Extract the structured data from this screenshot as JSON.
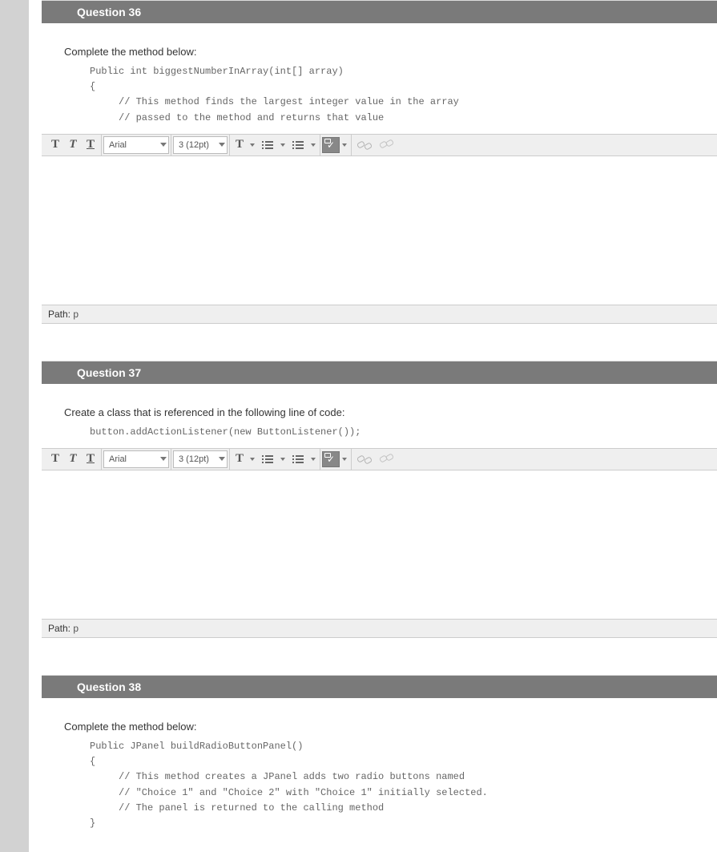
{
  "toolbar": {
    "bold": "T",
    "italic": "T",
    "underline": "T",
    "font_family": "Arial",
    "font_size": "3 (12pt)",
    "text_color_label": "T",
    "check_label": "✓"
  },
  "path": {
    "label": "Path:",
    "value": "p"
  },
  "questions": [
    {
      "id": "q36",
      "header": "Question 36",
      "prompt": "Complete the method below:",
      "code": "Public int biggestNumberInArray(int[] array)\n{\n     // This method finds the largest integer value in the array\n     // passed to the method and returns that value",
      "has_editor": true
    },
    {
      "id": "q37",
      "header": "Question 37",
      "prompt": "Create a class that is referenced in the following line of code:",
      "code": "button.addActionListener(new ButtonListener());",
      "has_editor": true
    },
    {
      "id": "q38",
      "header": "Question 38",
      "prompt": "Complete the method below:",
      "code": "Public JPanel buildRadioButtonPanel()\n{\n     // This method creates a JPanel adds two radio buttons named\n     // \"Choice 1\" and \"Choice 2\" with \"Choice 1\" initially selected.\n     // The panel is returned to the calling method\n}",
      "has_editor": false
    }
  ]
}
